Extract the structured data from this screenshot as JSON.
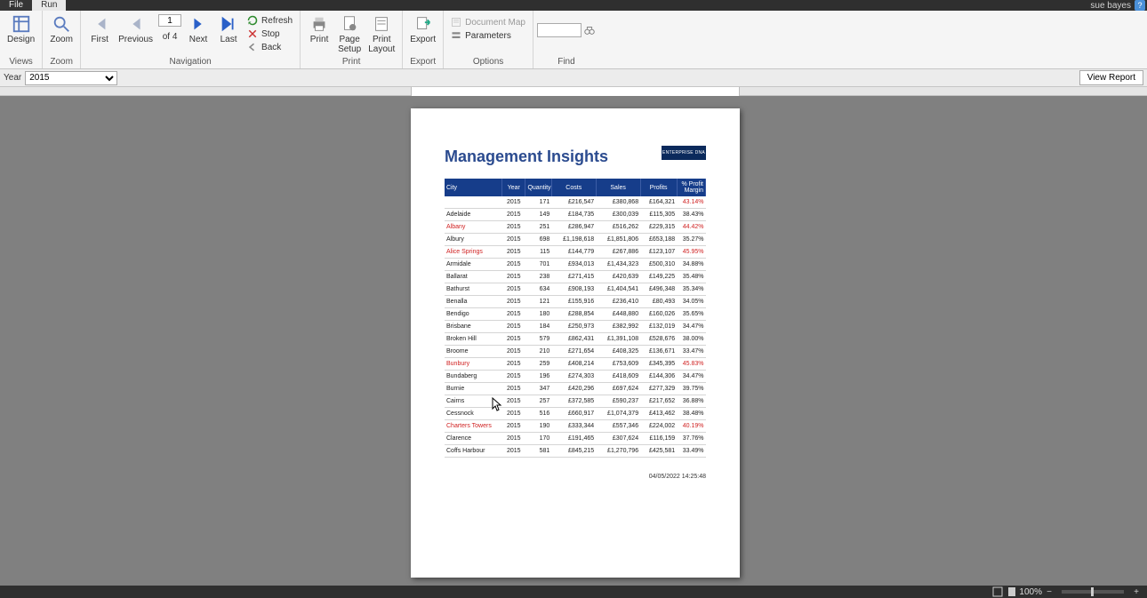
{
  "titlebar": {
    "username": "sue bayes"
  },
  "tabs": {
    "file": "File",
    "run": "Run"
  },
  "ribbon": {
    "views": {
      "design": "Design",
      "label": "Views"
    },
    "zoom": {
      "zoom": "Zoom",
      "label": "Zoom"
    },
    "navigation": {
      "first": "First",
      "previous": "Previous",
      "next": "Next",
      "last": "Last",
      "page_current": "1",
      "page_of": "of  4",
      "refresh": "Refresh",
      "stop": "Stop",
      "back": "Back",
      "label": "Navigation"
    },
    "print": {
      "print": "Print",
      "page_setup": "Page\nSetup",
      "print_layout": "Print\nLayout",
      "label": "Print"
    },
    "export": {
      "export": "Export",
      "label": "Export"
    },
    "options": {
      "document_map": "Document Map",
      "parameters": "Parameters",
      "label": "Options"
    },
    "find": {
      "placeholder": "",
      "label": "Find"
    }
  },
  "params": {
    "year_label": "Year",
    "year_value": "2015",
    "view_report": "View Report"
  },
  "report": {
    "title": "Management Insights",
    "logo_text": "ENTERPRISE DNA",
    "headers": {
      "city": "City",
      "year": "Year",
      "quantity": "Quantity",
      "costs": "Costs",
      "sales": "Sales",
      "profits": "Profits",
      "margin": "% Profit\nMargin"
    },
    "rows": [
      {
        "city": "",
        "year": "2015",
        "qty": "171",
        "costs": "£216,547",
        "sales": "£380,868",
        "profits": "£164,321",
        "margin": "43.14%",
        "hl": true
      },
      {
        "city": "Adelaide",
        "year": "2015",
        "qty": "149",
        "costs": "£184,735",
        "sales": "£300,039",
        "profits": "£115,305",
        "margin": "38.43%"
      },
      {
        "city": "Albany",
        "year": "2015",
        "qty": "251",
        "costs": "£286,947",
        "sales": "£516,262",
        "profits": "£229,315",
        "margin": "44.42%",
        "hl": true
      },
      {
        "city": "Albury",
        "year": "2015",
        "qty": "698",
        "costs": "£1,198,618",
        "sales": "£1,851,806",
        "profits": "£653,188",
        "margin": "35.27%"
      },
      {
        "city": "Alice Springs",
        "year": "2015",
        "qty": "115",
        "costs": "£144,779",
        "sales": "£267,886",
        "profits": "£123,107",
        "margin": "45.95%",
        "hl": true
      },
      {
        "city": "Armidale",
        "year": "2015",
        "qty": "701",
        "costs": "£934,013",
        "sales": "£1,434,323",
        "profits": "£500,310",
        "margin": "34.88%"
      },
      {
        "city": "Ballarat",
        "year": "2015",
        "qty": "238",
        "costs": "£271,415",
        "sales": "£420,639",
        "profits": "£149,225",
        "margin": "35.48%"
      },
      {
        "city": "Bathurst",
        "year": "2015",
        "qty": "634",
        "costs": "£908,193",
        "sales": "£1,404,541",
        "profits": "£496,348",
        "margin": "35.34%"
      },
      {
        "city": "Benalla",
        "year": "2015",
        "qty": "121",
        "costs": "£155,916",
        "sales": "£236,410",
        "profits": "£80,493",
        "margin": "34.05%"
      },
      {
        "city": "Bendigo",
        "year": "2015",
        "qty": "180",
        "costs": "£288,854",
        "sales": "£448,880",
        "profits": "£160,026",
        "margin": "35.65%"
      },
      {
        "city": "Brisbane",
        "year": "2015",
        "qty": "184",
        "costs": "£250,973",
        "sales": "£382,992",
        "profits": "£132,019",
        "margin": "34.47%"
      },
      {
        "city": "Broken Hill",
        "year": "2015",
        "qty": "579",
        "costs": "£862,431",
        "sales": "£1,391,108",
        "profits": "£528,676",
        "margin": "38.00%"
      },
      {
        "city": "Broome",
        "year": "2015",
        "qty": "210",
        "costs": "£271,654",
        "sales": "£408,325",
        "profits": "£136,671",
        "margin": "33.47%"
      },
      {
        "city": "Bunbury",
        "year": "2015",
        "qty": "259",
        "costs": "£408,214",
        "sales": "£753,609",
        "profits": "£345,395",
        "margin": "45.83%",
        "hl": true
      },
      {
        "city": "Bundaberg",
        "year": "2015",
        "qty": "196",
        "costs": "£274,303",
        "sales": "£418,609",
        "profits": "£144,306",
        "margin": "34.47%"
      },
      {
        "city": "Burnie",
        "year": "2015",
        "qty": "347",
        "costs": "£420,296",
        "sales": "£697,624",
        "profits": "£277,329",
        "margin": "39.75%"
      },
      {
        "city": "Cairns",
        "year": "2015",
        "qty": "257",
        "costs": "£372,585",
        "sales": "£590,237",
        "profits": "£217,652",
        "margin": "36.88%"
      },
      {
        "city": "Cessnock",
        "year": "2015",
        "qty": "516",
        "costs": "£660,917",
        "sales": "£1,074,379",
        "profits": "£413,462",
        "margin": "38.48%"
      },
      {
        "city": "Charters Towers",
        "year": "2015",
        "qty": "190",
        "costs": "£333,344",
        "sales": "£557,346",
        "profits": "£224,002",
        "margin": "40.19%",
        "hl": true
      },
      {
        "city": "Clarence",
        "year": "2015",
        "qty": "170",
        "costs": "£191,465",
        "sales": "£307,624",
        "profits": "£116,159",
        "margin": "37.76%"
      },
      {
        "city": "Coffs Harbour",
        "year": "2015",
        "qty": "581",
        "costs": "£845,215",
        "sales": "£1,270,796",
        "profits": "£425,581",
        "margin": "33.49%"
      }
    ],
    "footer_timestamp": "04/05/2022 14:25:48"
  },
  "statusbar": {
    "zoom_pct": "100%"
  }
}
